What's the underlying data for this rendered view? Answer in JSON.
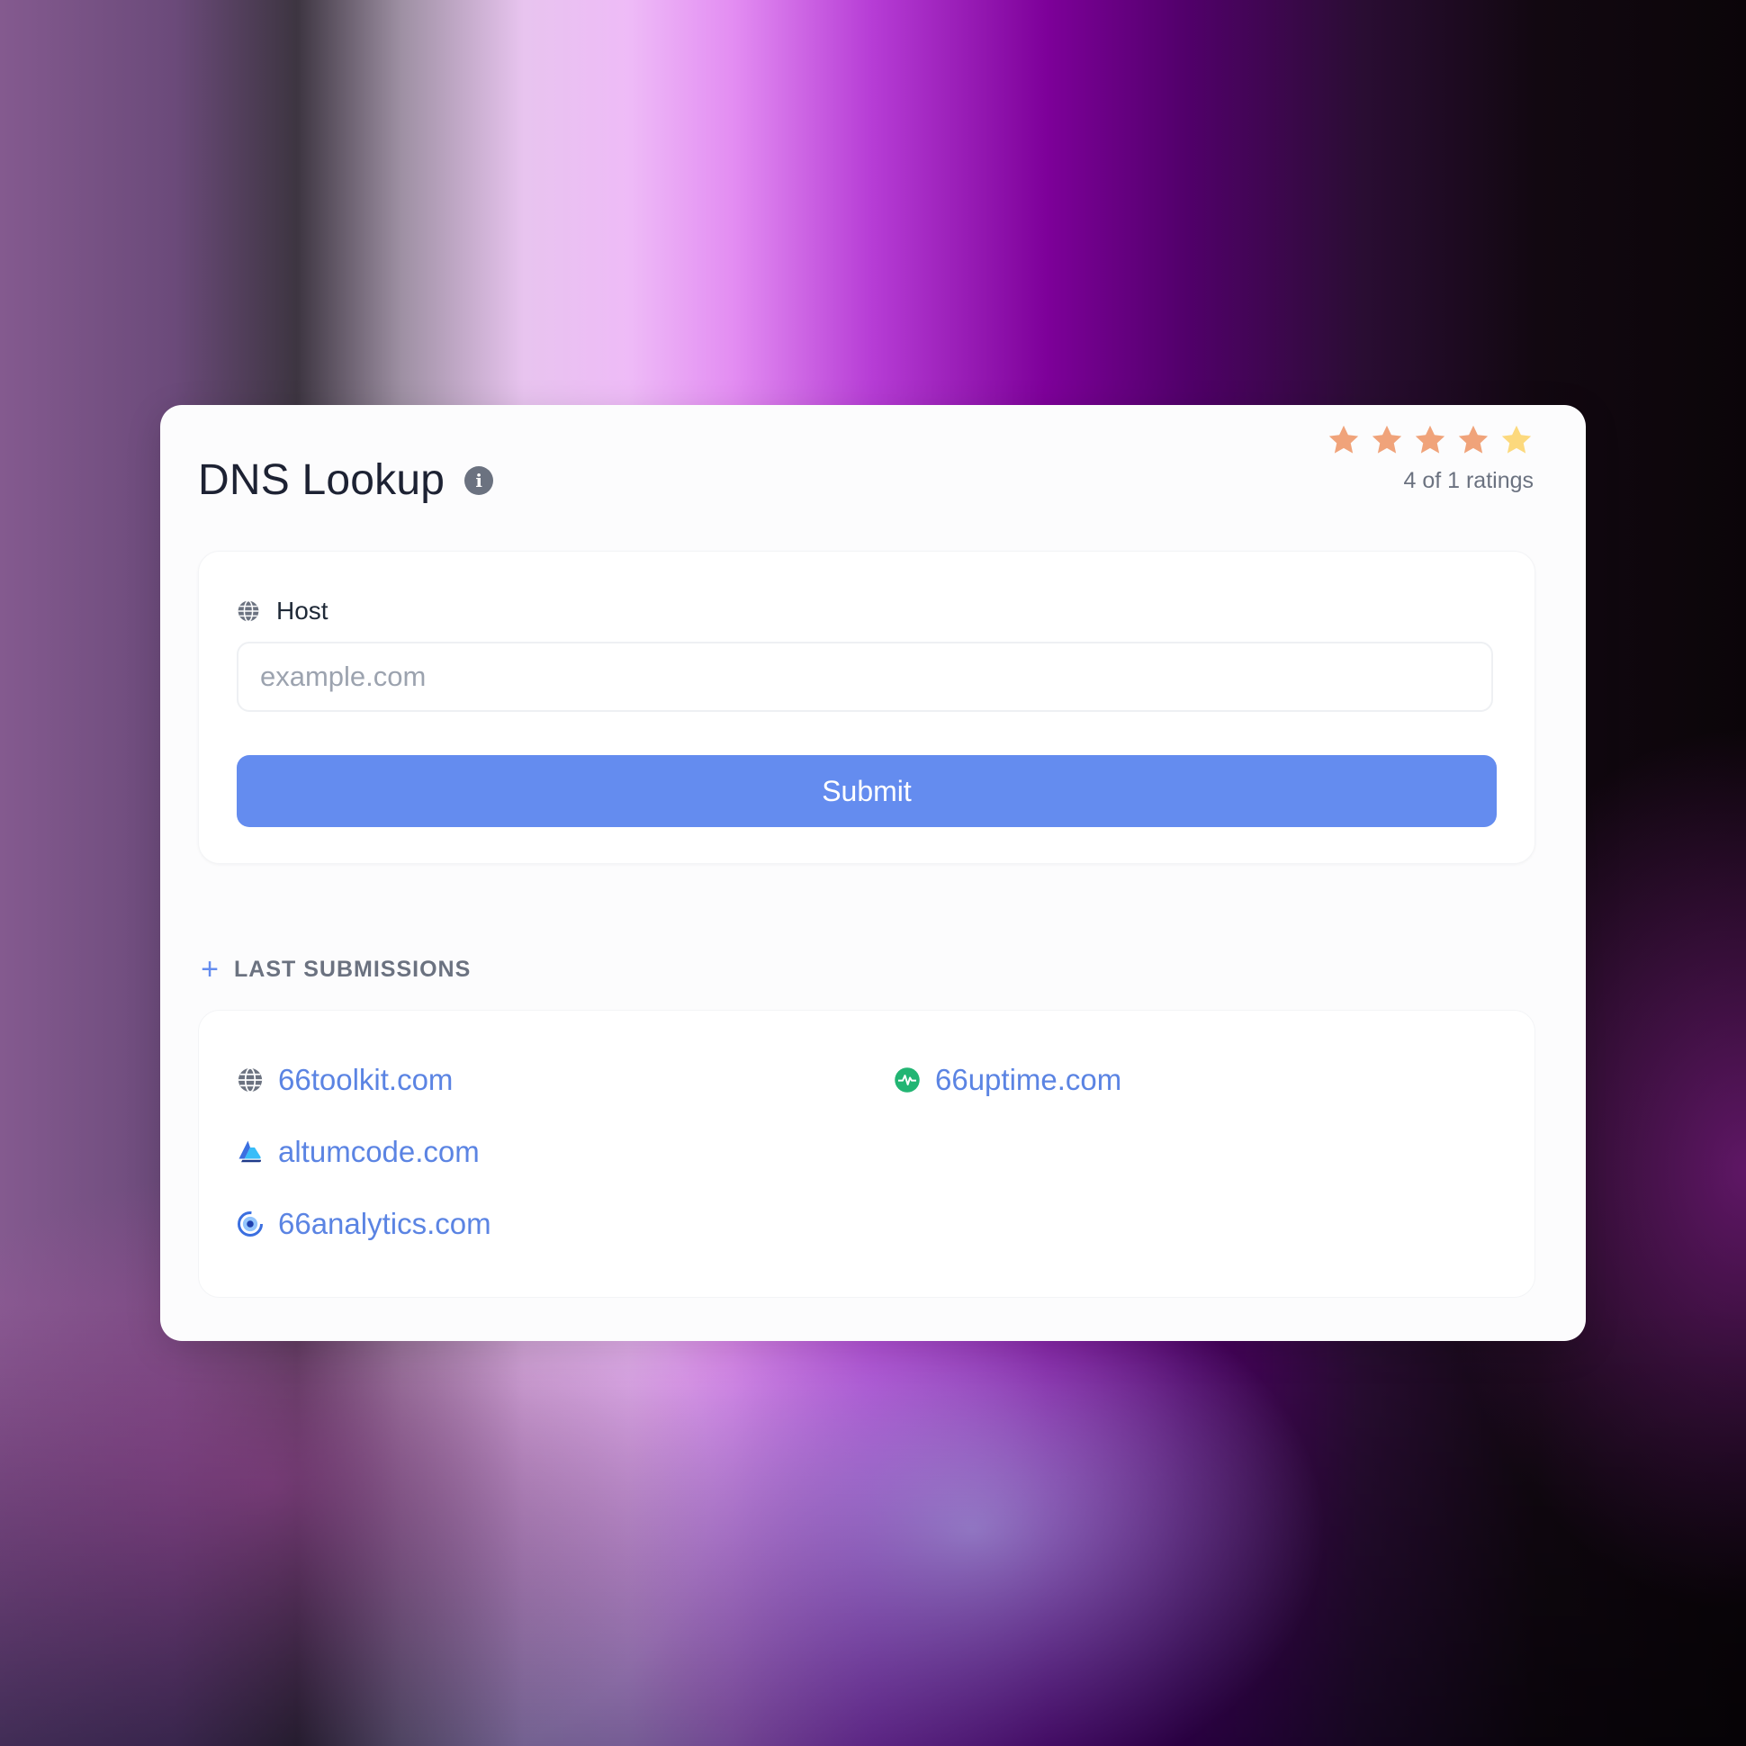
{
  "tool": {
    "title": "DNS Lookup",
    "info_icon": "info-icon"
  },
  "rating": {
    "value": 4,
    "max": 5,
    "text": "4 of 1 ratings",
    "star_color": "#f0a37a",
    "last_star_color": "#fcd97d"
  },
  "form": {
    "host_label": "Host",
    "host_icon": "globe-icon",
    "host_value": "",
    "host_placeholder": "example.com",
    "submit_label": "Submit",
    "accent": "#648cef"
  },
  "last_submissions": {
    "toggle_icon": "plus-icon",
    "title": "LAST SUBMISSIONS",
    "items": [
      {
        "label": "66toolkit.com",
        "icon": "globe-icon"
      },
      {
        "label": "66uptime.com",
        "icon": "uptime-pulse-icon"
      },
      {
        "label": "altumcode.com",
        "icon": "altumcode-logo-icon"
      },
      {
        "label": "66analytics.com",
        "icon": "analytics-eye-icon"
      }
    ]
  }
}
